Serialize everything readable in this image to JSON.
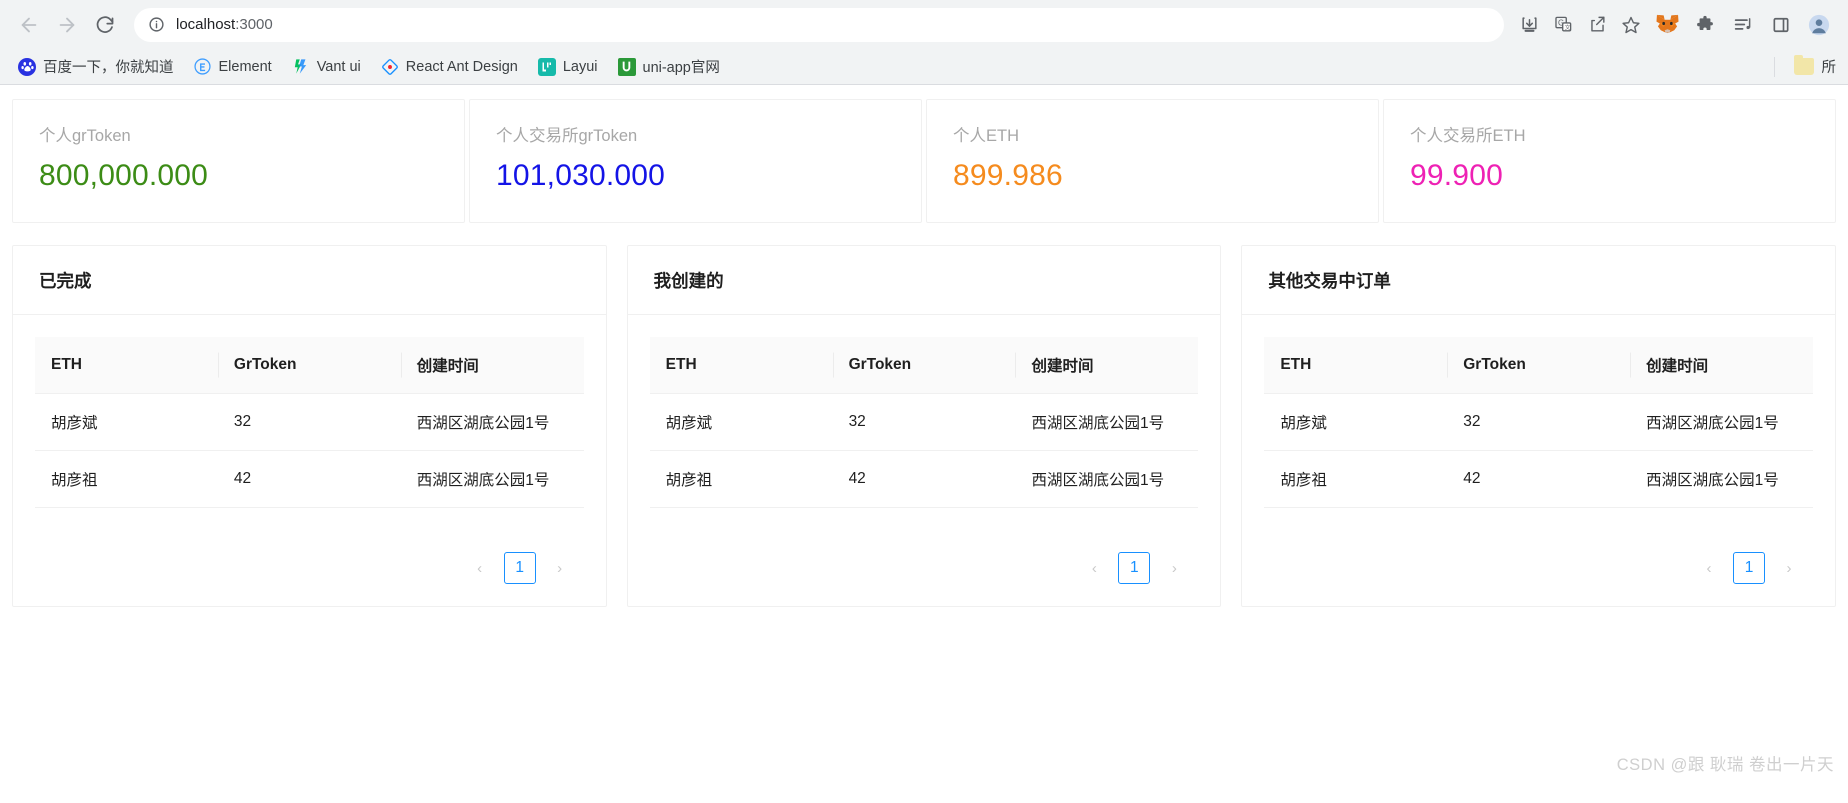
{
  "browser": {
    "back_label": "back-arrow",
    "forward_label": "forward-arrow",
    "reload_label": "reload",
    "url_host": "localhost",
    "url_port": ":3000",
    "url_full": "localhost:3000",
    "site_info_icon": "info-circle-icon",
    "actions": [
      {
        "name": "install-app-icon",
        "label": ""
      },
      {
        "name": "translate-icon",
        "label": ""
      },
      {
        "name": "share-icon",
        "label": ""
      },
      {
        "name": "bookmark-star-icon",
        "label": ""
      }
    ],
    "extensions": [
      {
        "name": "metamask-icon",
        "label": ""
      },
      {
        "name": "extensions-puzzle-icon",
        "label": ""
      },
      {
        "name": "reading-list-icon",
        "label": ""
      },
      {
        "name": "side-panel-icon",
        "label": ""
      },
      {
        "name": "profile-avatar-icon",
        "label": ""
      }
    ],
    "bookmarks": [
      {
        "label": "百度一下，你就知道",
        "icon": "baidu-icon",
        "color": "#2932e1"
      },
      {
        "label": "Element",
        "icon": "element-icon",
        "color": "#409eff"
      },
      {
        "label": "Vant ui",
        "icon": "vant-icon",
        "color": "#07c160"
      },
      {
        "label": "React Ant Design",
        "icon": "antd-icon",
        "color": "#1890ff"
      },
      {
        "label": "Layui",
        "icon": "layui-icon",
        "color": "#16baaa"
      },
      {
        "label": "uni-app官网",
        "icon": "uniapp-icon",
        "color": "#2b9939"
      }
    ]
  },
  "stats": [
    {
      "title": "个人grToken",
      "value": "800,000.000",
      "color": "#3c8c16"
    },
    {
      "title": "个人交易所grToken",
      "value": "101,030.000",
      "color": "#1414e6"
    },
    {
      "title": "个人ETH",
      "value": "899.986",
      "color": "#f58b1e"
    },
    {
      "title": "个人交易所ETH",
      "value": "99.900",
      "color": "#ee21b4"
    }
  ],
  "tables": [
    {
      "title": "已完成",
      "columns": [
        "ETH",
        "GrToken",
        "创建时间"
      ],
      "rows": [
        [
          "胡彦斌",
          "32",
          "西湖区湖底公园1号"
        ],
        [
          "胡彦祖",
          "42",
          "西湖区湖底公园1号"
        ]
      ],
      "pagination": {
        "prev": "‹",
        "current": "1",
        "next": "›"
      }
    },
    {
      "title": "我创建的",
      "columns": [
        "ETH",
        "GrToken",
        "创建时间"
      ],
      "rows": [
        [
          "胡彦斌",
          "32",
          "西湖区湖底公园1号"
        ],
        [
          "胡彦祖",
          "42",
          "西湖区湖底公园1号"
        ]
      ],
      "pagination": {
        "prev": "‹",
        "current": "1",
        "next": "›"
      }
    },
    {
      "title": "其他交易中订单",
      "columns": [
        "ETH",
        "GrToken",
        "创建时间"
      ],
      "rows": [
        [
          "胡彦斌",
          "32",
          "西湖区湖底公园1号"
        ],
        [
          "胡彦祖",
          "42",
          "西湖区湖底公园1号"
        ]
      ],
      "pagination": {
        "prev": "‹",
        "current": "1",
        "next": "›"
      }
    }
  ],
  "watermark": "CSDN @跟 耿瑞 卷出一片天"
}
